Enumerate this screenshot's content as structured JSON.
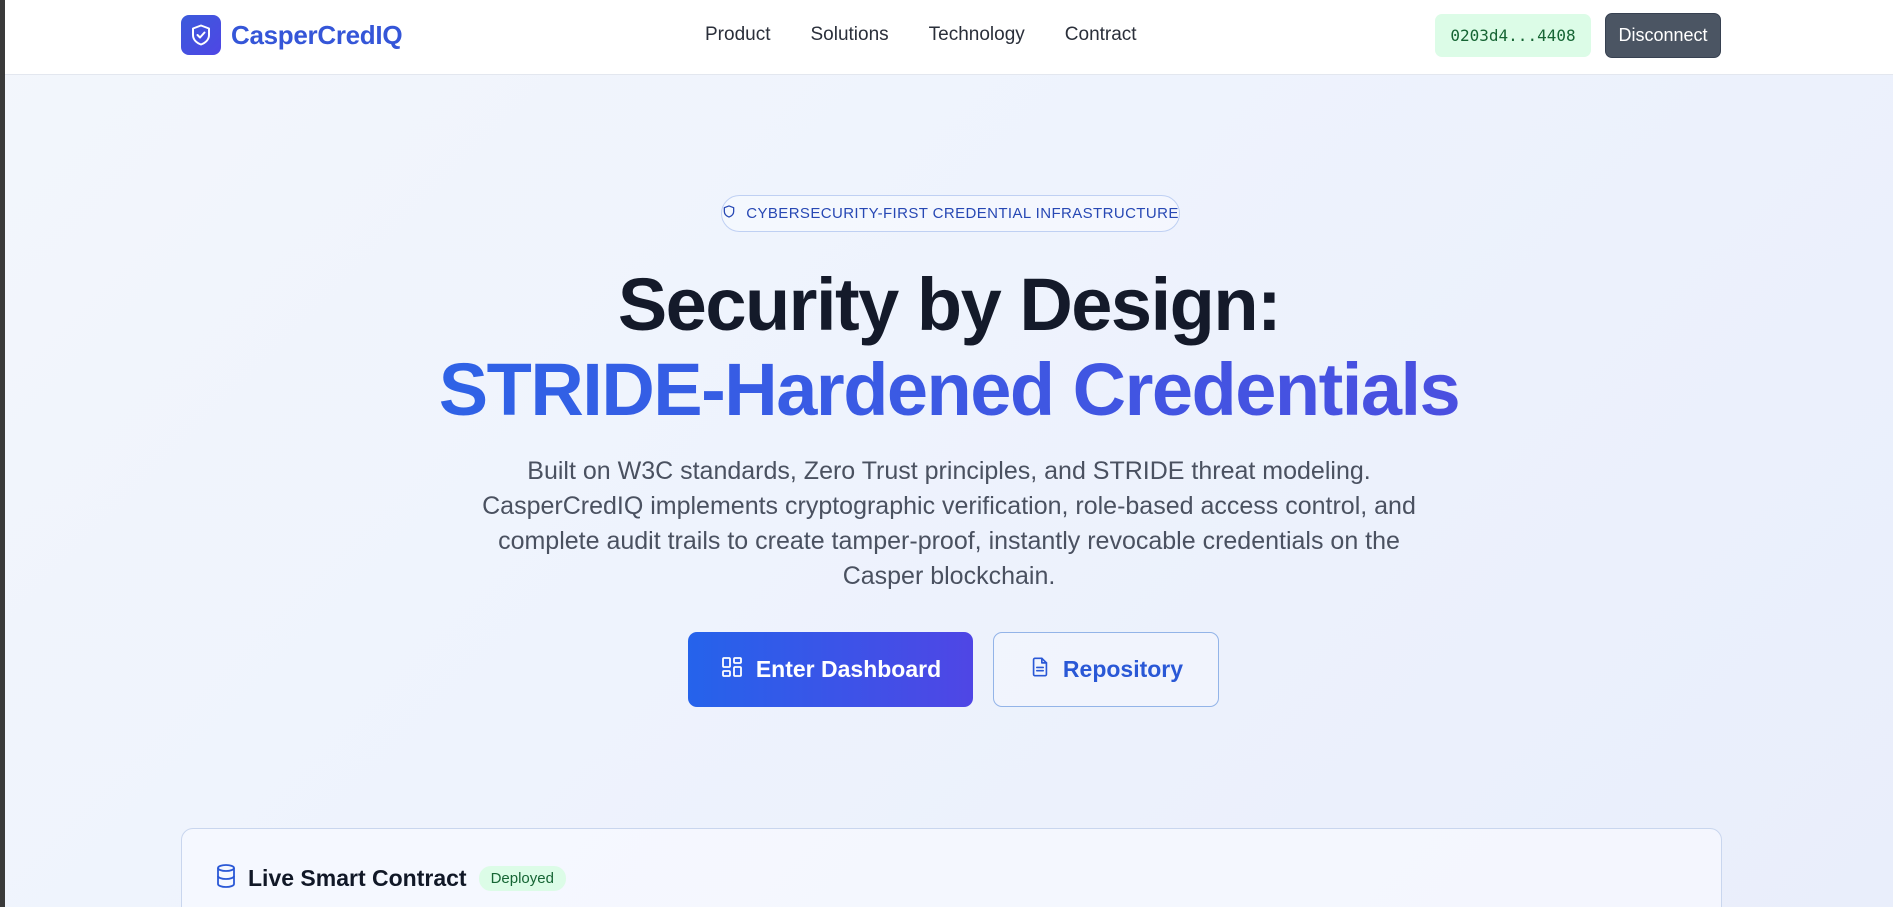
{
  "header": {
    "brand": "CasperCredIQ",
    "nav": [
      "Product",
      "Solutions",
      "Technology",
      "Contract"
    ],
    "wallet_address": "0203d4...4408",
    "disconnect_label": "Disconnect"
  },
  "hero": {
    "badge": "CYBERSECURITY-FIRST CREDENTIAL INFRASTRUCTURE",
    "title_line1": "Security by Design:",
    "title_line2": "STRIDE-Hardened Credentials",
    "description": "Built on W3C standards, Zero Trust principles, and STRIDE threat modeling. CasperCredIQ implements cryptographic verification, role-based access control, and complete audit trails to create tamper-proof, instantly revocable credentials on the Casper blockchain.",
    "primary_cta": "Enter Dashboard",
    "secondary_cta": "Repository"
  },
  "contract_card": {
    "title": "Live Smart Contract",
    "status": "Deployed"
  },
  "colors": {
    "accent": "#3b5bdb",
    "primary_gradient_start": "#2563eb",
    "primary_gradient_end": "#4f46e5",
    "success_bg": "#dcfce7",
    "success_text": "#166534",
    "heading": "#141a2a"
  },
  "icons": {
    "brand": "shield-check-icon",
    "badge": "shield-icon",
    "primary_cta": "grid-icon",
    "secondary_cta": "document-icon",
    "contract_card": "database-icon"
  }
}
